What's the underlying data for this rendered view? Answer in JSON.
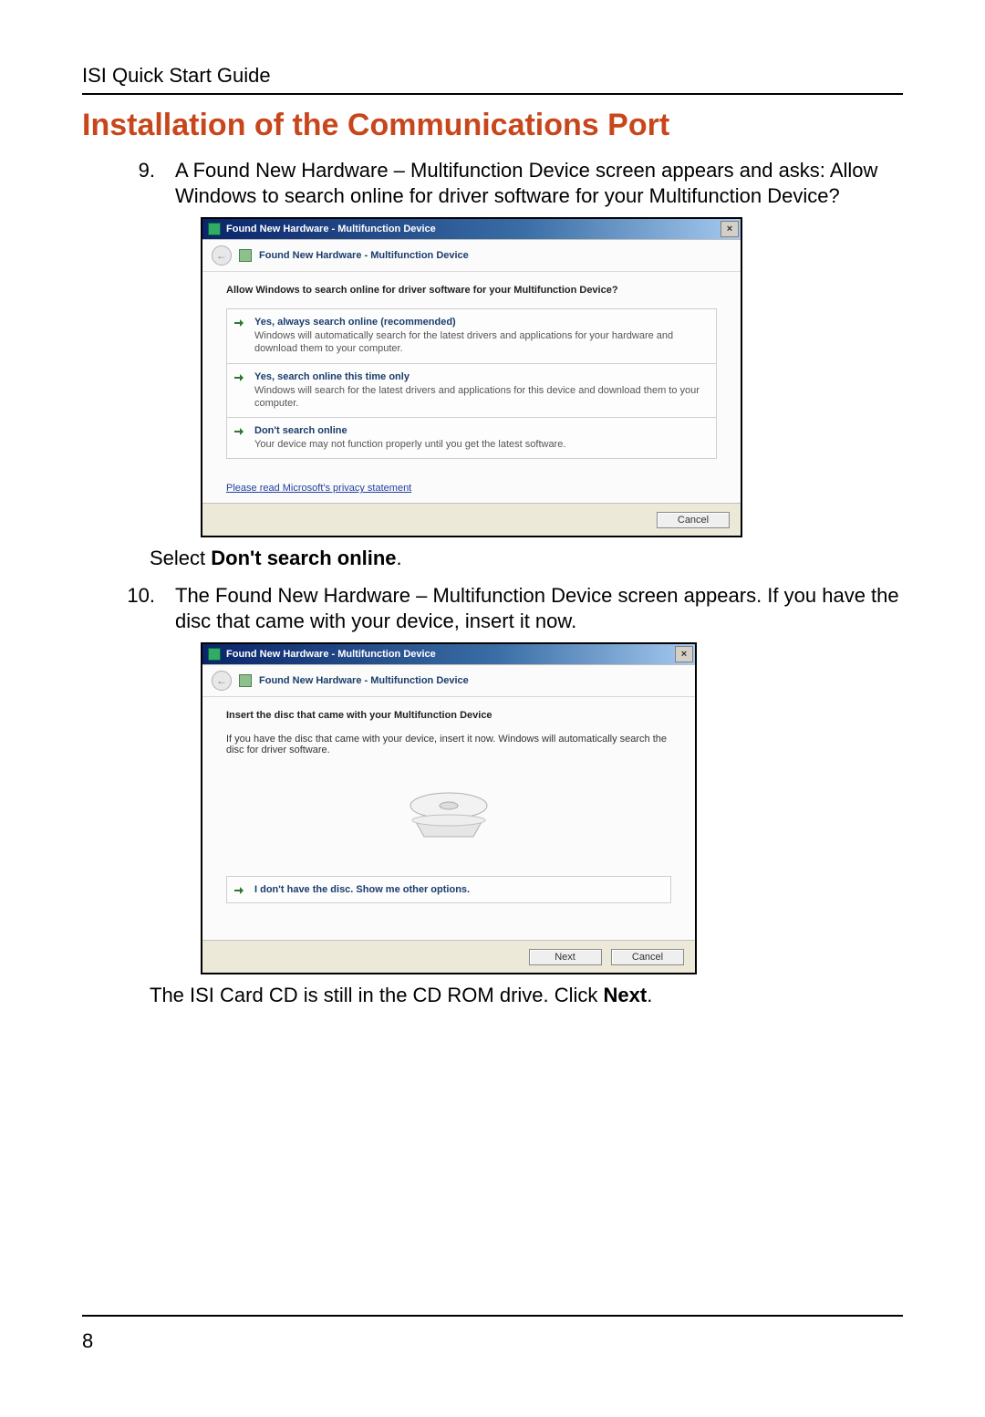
{
  "header": "ISI Quick Start Guide",
  "title": "Installation of the Communications Port",
  "page_number": "8",
  "step9": {
    "text": "A Found New Hardware – Multifunction Device screen appears and asks: Allow Windows to search online for driver software for your Multifunction Device?",
    "after_prefix": "Select ",
    "after_bold": "Don't search online",
    "after_suffix": "."
  },
  "step10": {
    "text": "The Found New Hardware – Multifunction Device screen appears. If you have the disc that came with your device, insert it now.",
    "after_prefix": "The ISI Card CD is still in the CD ROM drive. Click ",
    "after_bold": "Next",
    "after_suffix": "."
  },
  "dialog1": {
    "title": "Found New Hardware - Multifunction Device",
    "header": "Found New Hardware - Multifunction Device",
    "prompt": "Allow Windows to search online for driver software for your Multifunction Device?",
    "opt1_title": "Yes, always search online (recommended)",
    "opt1_desc": "Windows will automatically search for the latest drivers and applications for your hardware and download them to your computer.",
    "opt2_title": "Yes, search online this time only",
    "opt2_desc": "Windows will search for the latest drivers and applications for this device and download them to your computer.",
    "opt3_title": "Don't search online",
    "opt3_desc": "Your device may not function properly until you get the latest software.",
    "privacy": "Please read Microsoft's  privacy statement",
    "cancel": "Cancel"
  },
  "dialog2": {
    "title": "Found New Hardware - Multifunction Device",
    "header": "Found New Hardware - Multifunction Device",
    "prompt": "Insert the disc that came with your Multifunction Device",
    "desc": "If you have the disc that came with your device, insert it now.  Windows will automatically search the disc for driver software.",
    "opt_title": "I don't have the disc.  Show me other options.",
    "next": "Next",
    "cancel": "Cancel"
  }
}
